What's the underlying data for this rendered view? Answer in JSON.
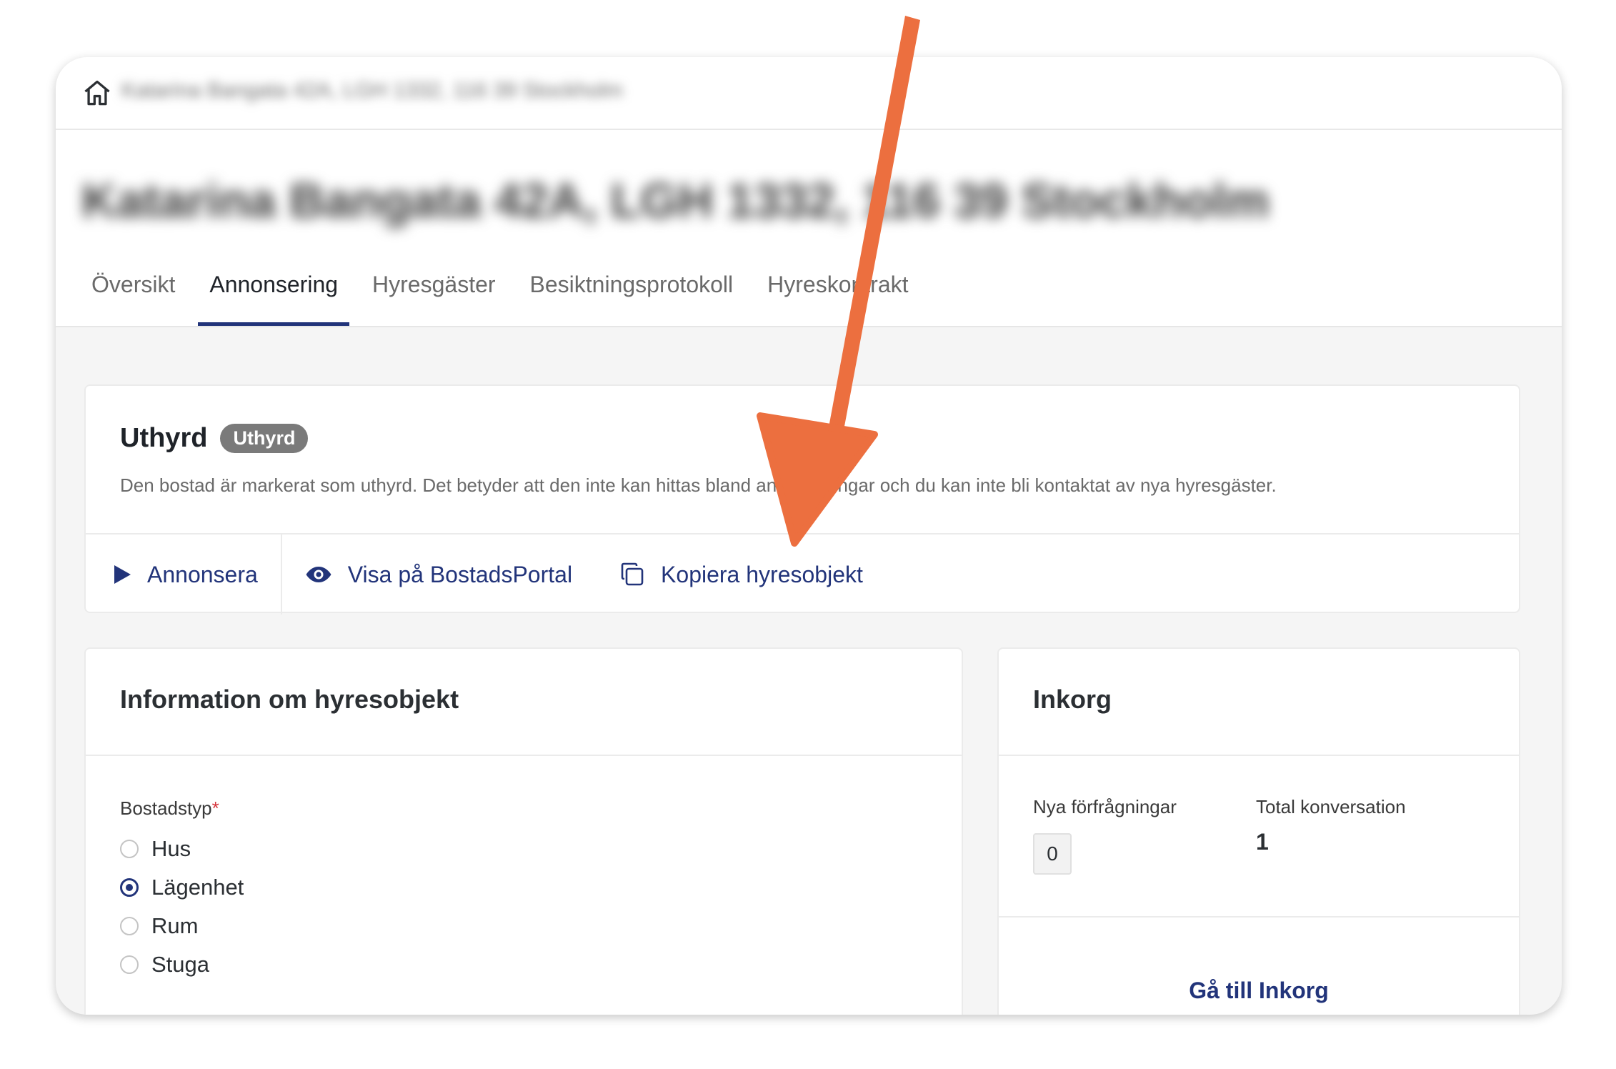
{
  "topbar": {
    "icon": "home-icon",
    "breadcrumb": "Katarina Bangata 42A, LGH 1332, 116 39 Stockholm"
  },
  "header": {
    "title": "Katarina Bangata 42A, LGH 1332, 116 39 Stockholm",
    "tabs": [
      {
        "label": "Översikt",
        "active": false
      },
      {
        "label": "Annonsering",
        "active": true
      },
      {
        "label": "Hyresgäster",
        "active": false
      },
      {
        "label": "Besiktningsprotokoll",
        "active": false
      },
      {
        "label": "Hyreskontrakt",
        "active": false
      }
    ]
  },
  "status": {
    "title": "Uthyrd",
    "badge": "Uthyrd",
    "description": "Den bostad är markerat som uthyrd. Det betyder att den inte kan hittas bland annonseringar och du kan inte bli kontaktat av nya hyresgäster.",
    "actions": [
      {
        "label": "Annonsera",
        "icon": "play-icon"
      },
      {
        "label": "Visa på BostadsPortal",
        "icon": "eye-icon"
      },
      {
        "label": "Kopiera hyresobjekt",
        "icon": "copy-icon"
      }
    ]
  },
  "info": {
    "title": "Information om hyresobjekt",
    "field_label": "Bostadstyp",
    "required_marker": "*",
    "options": [
      {
        "label": "Hus",
        "checked": false
      },
      {
        "label": "Lägenhet",
        "checked": true
      },
      {
        "label": "Rum",
        "checked": false
      },
      {
        "label": "Stuga",
        "checked": false
      }
    ]
  },
  "inbox": {
    "title": "Inkorg",
    "new_requests_label": "Nya förfrågningar",
    "new_requests_count": "0",
    "total_label": "Total konversation",
    "total_count": "1",
    "link_label": "Gå till Inkorg"
  },
  "colors": {
    "accent": "#22347a",
    "arrow": "#ec6f3f",
    "badge": "#7a7a7a",
    "required": "#d6363d"
  }
}
